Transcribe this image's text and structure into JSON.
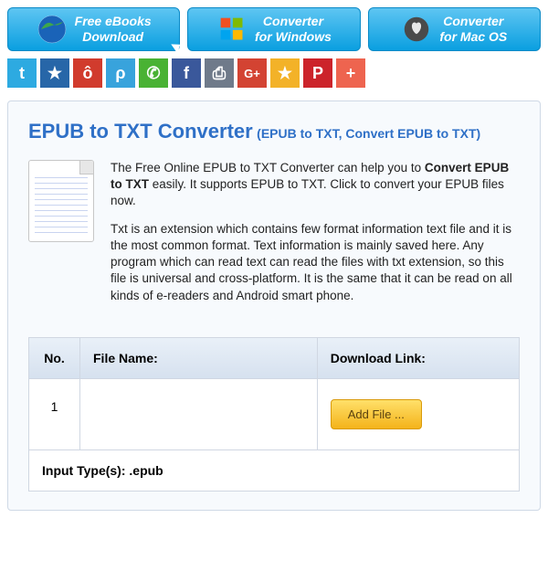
{
  "topbar": [
    {
      "label": "Free eBooks\nDownload",
      "icon": "globe-icon"
    },
    {
      "label": "Converter\nfor Windows",
      "icon": "windows-icon"
    },
    {
      "label": "Converter\nfor Mac OS",
      "icon": "mac-icon"
    }
  ],
  "share": [
    {
      "name": "twitter",
      "bg": "#2daae1",
      "glyph": "t"
    },
    {
      "name": "qzone",
      "bg": "#2766a8",
      "glyph": "★"
    },
    {
      "name": "weibo",
      "bg": "#d13b2d",
      "glyph": "ô"
    },
    {
      "name": "tencent",
      "bg": "#38a3dc",
      "glyph": "ρ"
    },
    {
      "name": "wechat",
      "bg": "#49b233",
      "glyph": "✆"
    },
    {
      "name": "facebook",
      "bg": "#3a589b",
      "glyph": "f"
    },
    {
      "name": "print",
      "bg": "#6f7a8a",
      "glyph": "⎙"
    },
    {
      "name": "gplus",
      "bg": "#d34332",
      "glyph": "G+"
    },
    {
      "name": "fav",
      "bg": "#f3b228",
      "glyph": "★"
    },
    {
      "name": "pinterest",
      "bg": "#cc232a",
      "glyph": "P"
    },
    {
      "name": "more",
      "bg": "#ee644f",
      "glyph": "+"
    }
  ],
  "panel": {
    "title": "EPUB to TXT Converter",
    "subtitle": "(EPUB to TXT, Convert EPUB to TXT)",
    "intro_pre": "The Free Online EPUB to TXT Converter can help you to ",
    "intro_bold": "Convert EPUB to TXT",
    "intro_post": " easily. It supports EPUB to TXT. Click to convert your EPUB files now.",
    "para2": "Txt is an extension which contains few format information text file and it is the most common format. Text information is mainly saved here. Any program which can read text can read the files with txt extension, so this file is universal and cross-platform. It is the same that it can be read on all kinds of e-readers and Android smart phone."
  },
  "table": {
    "headers": {
      "no": "No.",
      "file": "File Name:",
      "dl": "Download Link:"
    },
    "rows": [
      {
        "no": "1",
        "file": "",
        "action": "Add File ..."
      }
    ],
    "footer": "Input Type(s): .epub"
  }
}
